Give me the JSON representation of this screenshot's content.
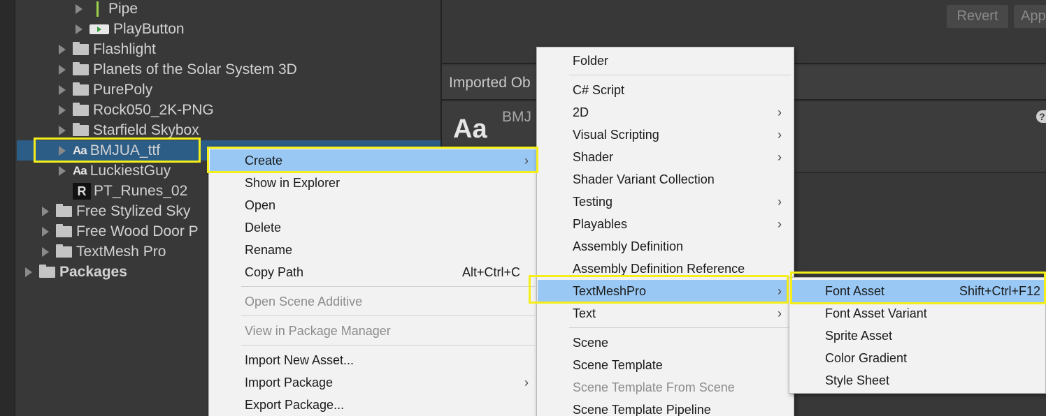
{
  "tree": {
    "items": [
      {
        "label": "Pipe",
        "icon": "pipe-icon",
        "expanded": false
      },
      {
        "label": "PlayButton",
        "icon": "playbutton-icon",
        "expanded": false
      },
      {
        "label": "Flashlight",
        "icon": "folder-icon",
        "expanded": false
      },
      {
        "label": "Planets of the Solar System 3D",
        "icon": "folder-icon",
        "expanded": false
      },
      {
        "label": "PurePoly",
        "icon": "folder-icon",
        "expanded": false
      },
      {
        "label": "Rock050_2K-PNG",
        "icon": "folder-icon",
        "expanded": false
      },
      {
        "label": "Starfield Skybox",
        "icon": "folder-icon",
        "expanded": false
      },
      {
        "label": "BMJUA_ttf",
        "icon": "font-icon",
        "icon_text": "Aa",
        "selected": true
      },
      {
        "label": "LuckiestGuy",
        "icon": "font-icon",
        "icon_text": "Aa"
      },
      {
        "label": "PT_Runes_02",
        "icon": "rune-icon",
        "icon_text": "R"
      },
      {
        "label": "Free Stylized Sky",
        "icon": "folder-icon"
      },
      {
        "label": "Free Wood Door P",
        "icon": "folder-icon"
      },
      {
        "label": "TextMesh Pro",
        "icon": "folder-icon"
      },
      {
        "label": "Packages",
        "icon": "folder-icon"
      }
    ]
  },
  "inspector": {
    "revert_label": "Revert",
    "apply_label": "App",
    "imported_object_label": "Imported Ob",
    "font_preview_text": "Aa",
    "font_name": "BMJ",
    "help_icon_text": "?"
  },
  "context_menu": {
    "items": [
      {
        "label": "Create",
        "submenu": true,
        "highlighted": true
      },
      {
        "label": "Show in Explorer"
      },
      {
        "label": "Open"
      },
      {
        "label": "Delete"
      },
      {
        "label": "Rename"
      },
      {
        "label": "Copy Path",
        "shortcut": "Alt+Ctrl+C"
      },
      {
        "label": "Open Scene Additive",
        "disabled": true
      },
      {
        "label": "View in Package Manager",
        "disabled": true
      },
      {
        "label": "Import New Asset..."
      },
      {
        "label": "Import Package",
        "submenu": true
      },
      {
        "label": "Export Package..."
      }
    ]
  },
  "create_menu": {
    "items": [
      {
        "label": "Folder"
      },
      {
        "label": "C# Script"
      },
      {
        "label": "2D",
        "submenu": true
      },
      {
        "label": "Visual Scripting",
        "submenu": true
      },
      {
        "label": "Shader",
        "submenu": true
      },
      {
        "label": "Shader Variant Collection"
      },
      {
        "label": "Testing",
        "submenu": true
      },
      {
        "label": "Playables",
        "submenu": true
      },
      {
        "label": "Assembly Definition"
      },
      {
        "label": "Assembly Definition Reference"
      },
      {
        "label": "TextMeshPro",
        "submenu": true,
        "highlighted": true
      },
      {
        "label": "Text",
        "submenu": true
      },
      {
        "label": "Scene"
      },
      {
        "label": "Scene Template"
      },
      {
        "label": "Scene Template From Scene",
        "disabled": true
      },
      {
        "label": "Scene Template Pipeline"
      }
    ]
  },
  "textmeshpro_menu": {
    "items": [
      {
        "label": "Font Asset",
        "shortcut": "Shift+Ctrl+F12",
        "highlighted": true
      },
      {
        "label": "Font Asset Variant"
      },
      {
        "label": "Sprite Asset"
      },
      {
        "label": "Color Gradient"
      },
      {
        "label": "Style Sheet"
      }
    ]
  },
  "submenu_arrow_glyph": "›",
  "colors": {
    "background": "#383838",
    "selection": "#2c5d87",
    "menu_background": "#f2f2f2",
    "menu_highlight": "#99c8f4",
    "annotation_box": "#f4ee1a"
  }
}
